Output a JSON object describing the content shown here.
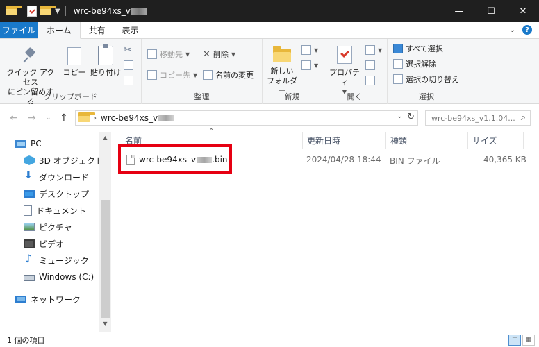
{
  "window": {
    "title": "wrc-be94xs_v",
    "controls": {
      "minimize": "—",
      "maximize": "☐",
      "close": "✕"
    }
  },
  "ribbon_tabs": [
    {
      "label": "ファイル"
    },
    {
      "label": "ホーム"
    },
    {
      "label": "共有"
    },
    {
      "label": "表示"
    }
  ],
  "ribbon": {
    "clipboard": {
      "label": "クリップボード",
      "pin_line1": "クイック アクセス",
      "pin_line2": "にピン留めする",
      "copy": "コピー",
      "paste": "貼り付け"
    },
    "organize": {
      "label": "整理",
      "move_to": "移動先",
      "copy_to": "コピー先",
      "delete": "削除",
      "rename": "名前の変更"
    },
    "new": {
      "label": "新規",
      "new_folder_line1": "新しい",
      "new_folder_line2": "フォルダー"
    },
    "open": {
      "label": "開く",
      "properties": "プロパティ"
    },
    "select": {
      "label": "選択",
      "select_all": "すべて選択",
      "select_none": "選択解除",
      "invert": "選択の切り替え"
    }
  },
  "address": {
    "path": "wrc-be94xs_v",
    "search_placeholder": "wrc-be94xs_v1.1.04..."
  },
  "nav_items": [
    {
      "label": "PC",
      "icon": "pc-icon"
    },
    {
      "label": "3D オブジェクト",
      "icon": "3d-objects-icon"
    },
    {
      "label": "ダウンロード",
      "icon": "downloads-icon"
    },
    {
      "label": "デスクトップ",
      "icon": "desktop-icon"
    },
    {
      "label": "ドキュメント",
      "icon": "documents-icon"
    },
    {
      "label": "ピクチャ",
      "icon": "pictures-icon"
    },
    {
      "label": "ビデオ",
      "icon": "videos-icon"
    },
    {
      "label": "ミュージック",
      "icon": "music-icon"
    },
    {
      "label": "Windows (C:)",
      "icon": "drive-icon"
    },
    {
      "label": "ネットワーク",
      "icon": "network-icon"
    }
  ],
  "columns": {
    "name": "名前",
    "modified": "更新日時",
    "type": "種類",
    "size": "サイズ"
  },
  "files": [
    {
      "name_prefix": "wrc-be94xs_v",
      "name_suffix": ".bin",
      "modified": "2024/04/28 18:44",
      "type": "BIN ファイル",
      "size": "40,365 KB"
    }
  ],
  "status": {
    "item_count": "1 個の項目"
  },
  "colors": {
    "titlebar": "#1f1f1f",
    "file_tab": "#1979ca",
    "highlight_box": "#e60012"
  }
}
